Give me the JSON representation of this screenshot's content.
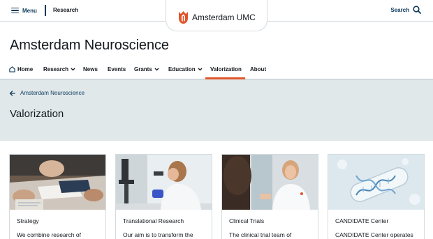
{
  "topbar": {
    "menu_label": "Menu",
    "section_link": "Research",
    "logo_text": "Amsterdam UMC",
    "search_label": "Search"
  },
  "site": {
    "title": "Amsterdam Neuroscience"
  },
  "nav": {
    "items": [
      {
        "label": "Home",
        "icon": "home-icon"
      },
      {
        "label": "Research",
        "icon": "chevron-down-icon"
      },
      {
        "label": "News"
      },
      {
        "label": "Events"
      },
      {
        "label": "Grants",
        "icon": "chevron-down-icon"
      },
      {
        "label": "Education",
        "icon": "chevron-down-icon"
      },
      {
        "label": "Valorization",
        "active": true
      },
      {
        "label": "About"
      }
    ]
  },
  "hero": {
    "back_label": "Amsterdam Neuroscience",
    "page_title": "Valorization"
  },
  "cards": [
    {
      "title": "Strategy",
      "text": "We combine research of",
      "image": "people at table with laptop and documents"
    },
    {
      "title": "Translational Research",
      "text": "Our aim is to transform the",
      "image": "researcher at microscope"
    },
    {
      "title": "Clinical Trials",
      "text": "The clinical trial team of",
      "image": "clinicians in conversation"
    },
    {
      "title": "CANDIDATE Center",
      "text": "CANDIDATE Center operates",
      "image": "DNA helix in vial"
    }
  ],
  "colors": {
    "brand_red": "#e0552b",
    "nav_blue": "#0b3a5c",
    "hero_bg": "#e1e8ea"
  }
}
